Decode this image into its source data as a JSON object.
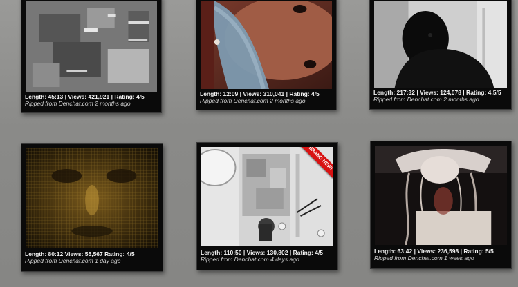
{
  "videos": [
    {
      "stats": "Length: 45:13  |  Views: 421,921  |  Rating: 4/5",
      "source": "Ripped from Denchat.com 2 months ago"
    },
    {
      "stats": "Length: 12:09  |  Views: 310,041  |  Rating: 4/5",
      "source": "Ripped from Denchat.com 2 months ago"
    },
    {
      "stats": "Length: 217:32  |  Views: 124,078  |  Rating: 4.5/5",
      "source": "Ripped from Denchat.com 2 months ago"
    },
    {
      "stats": "Length: 80:12  Views: 55,567  Rating: 4/5",
      "source": "Ripped from Denchat.com 1 day ago"
    },
    {
      "stats": "Length: 110:50  |  Views: 130,802  |  Rating: 4/5",
      "source": "Ripped from Denchat.com 4 days ago",
      "badge": "BRAND NEW!"
    },
    {
      "stats": "Length: 63:42  |  Views: 236,598  |  Rating: 5/5",
      "source": "Ripped from Denchat.com 1 week ago"
    }
  ],
  "colors": {
    "wall": "#8e8e8c",
    "card": "#0a0a0a",
    "badge": "#d81212"
  }
}
